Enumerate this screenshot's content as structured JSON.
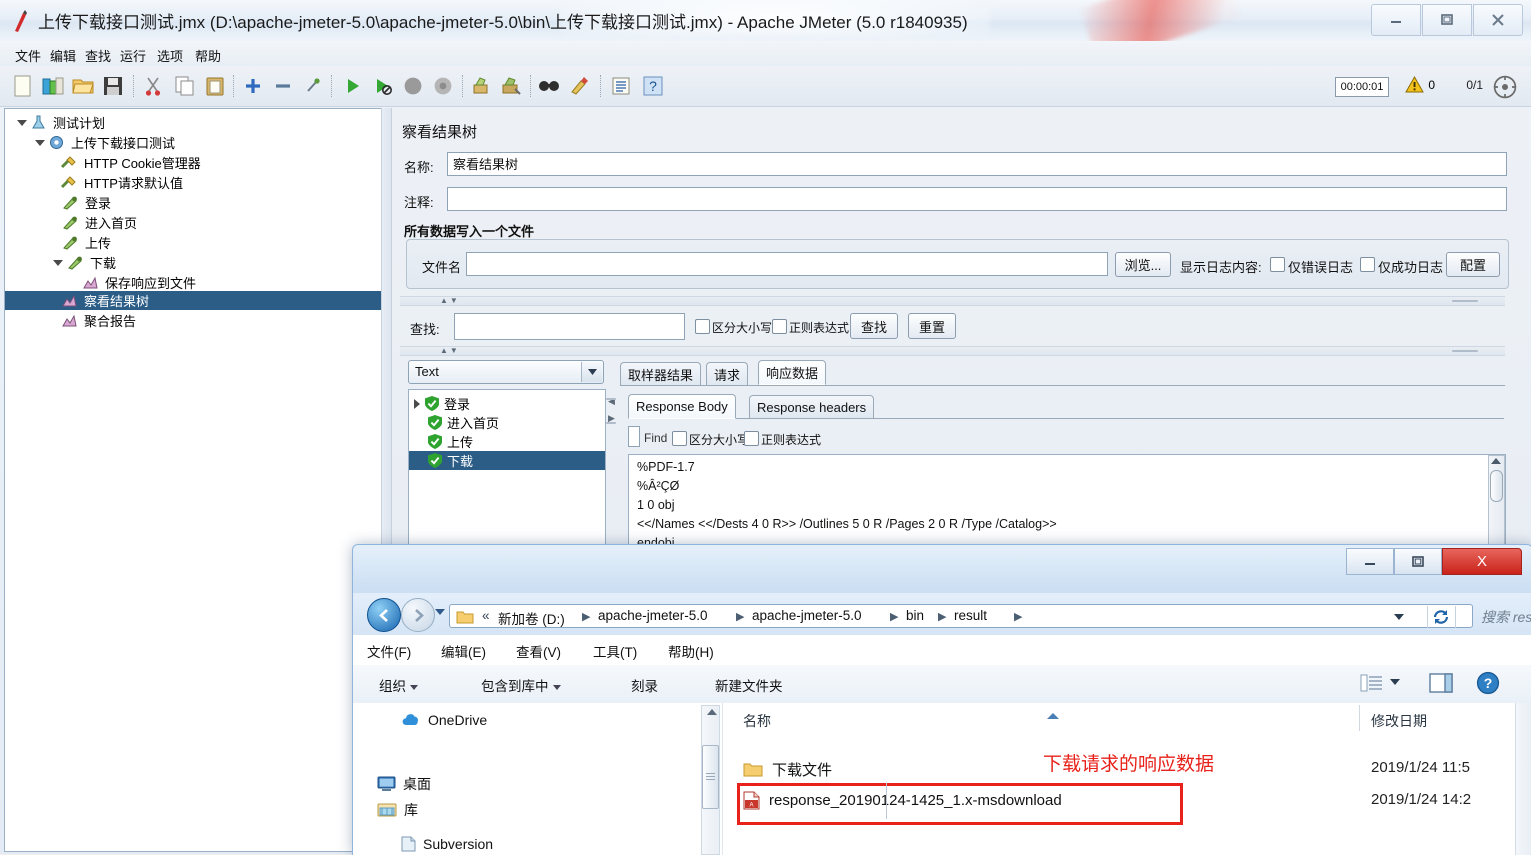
{
  "jmeter": {
    "title": "上传下载接口测试.jmx (D:\\apache-jmeter-5.0\\apache-jmeter-5.0\\bin\\上传下载接口测试.jmx) - Apache JMeter (5.0 r1840935)",
    "window_buttons": {
      "minimize": "—",
      "maximize": "❐",
      "close": "✕"
    },
    "menu": [
      "文件",
      "编辑",
      "查找",
      "运行",
      "选项",
      "帮助"
    ],
    "toolbar": {
      "icons": [
        "new-icon",
        "templates-icon",
        "open-icon",
        "save-icon",
        "cut-icon",
        "copy-icon",
        "paste-icon",
        "expand-icon",
        "collapse-icon",
        "toggle-icon",
        "start-icon",
        "start-no-pause-icon",
        "stop-icon",
        "shutdown-icon",
        "clear-icon",
        "clear-all-icon",
        "search-icon",
        "search-reset-icon",
        "function-helper-icon",
        "help-icon"
      ],
      "elapsed": "00:00:01",
      "warn_count": "0",
      "thread_ratio": "0/1"
    },
    "tree": {
      "nodes": [
        {
          "label": "测试计划",
          "icon": "test-plan-icon",
          "depth": 0,
          "toggle": "down",
          "selected": false
        },
        {
          "label": "上传下载接口测试",
          "icon": "thread-group-icon",
          "depth": 1,
          "toggle": "down",
          "selected": false
        },
        {
          "label": "HTTP Cookie管理器",
          "icon": "config-icon",
          "depth": 2,
          "toggle": "none",
          "selected": false
        },
        {
          "label": "HTTP请求默认值",
          "icon": "config-icon",
          "depth": 2,
          "toggle": "none",
          "selected": false
        },
        {
          "label": "登录",
          "icon": "http-sampler-icon",
          "depth": 2,
          "toggle": "none",
          "selected": false
        },
        {
          "label": "进入首页",
          "icon": "http-sampler-icon",
          "depth": 2,
          "toggle": "none",
          "selected": false
        },
        {
          "label": "上传",
          "icon": "http-sampler-icon",
          "depth": 2,
          "toggle": "none",
          "selected": false
        },
        {
          "label": "下载",
          "icon": "http-sampler-icon",
          "depth": 2,
          "toggle": "down",
          "selected": false
        },
        {
          "label": "保存响应到文件",
          "icon": "listener-icon",
          "depth": 3,
          "toggle": "none",
          "selected": false
        },
        {
          "label": "察看结果树",
          "icon": "listener-icon",
          "depth": 2,
          "toggle": "none",
          "selected": true
        },
        {
          "label": "聚合报告",
          "icon": "listener-icon",
          "depth": 2,
          "toggle": "none",
          "selected": false
        }
      ]
    },
    "panel": {
      "heading": "察看结果树",
      "name_label": "名称:",
      "name_value": "察看结果树",
      "comment_label": "注释:",
      "comment_value": "",
      "group_heading": "所有数据写入一个文件",
      "filename_label": "文件名",
      "filename_value": "",
      "browse_button": "浏览...",
      "log_display_label": "显示日志内容:",
      "errors_only": "仅错误日志",
      "success_only": "仅成功日志",
      "configure_button": "配置",
      "find_label": "查找:",
      "find_value": "",
      "case_sensitive": "区分大小写",
      "regex": "正则表达式",
      "find_button": "查找",
      "reset_button": "重置",
      "renderer_selected": "Text",
      "results": [
        {
          "label": "登录",
          "icon": "success-shield-icon",
          "toggle": "right",
          "selected": false
        },
        {
          "label": "进入首页",
          "icon": "success-shield-icon",
          "toggle": "none",
          "selected": false
        },
        {
          "label": "上传",
          "icon": "success-shield-icon",
          "toggle": "none",
          "selected": false
        },
        {
          "label": "下载",
          "icon": "success-shield-icon",
          "toggle": "none",
          "selected": true
        }
      ],
      "main_tabs": [
        {
          "label": "取样器结果",
          "active": false
        },
        {
          "label": "请求",
          "active": false
        },
        {
          "label": "响应数据",
          "active": true
        }
      ],
      "sub_tabs": [
        {
          "label": "Response Body",
          "active": true
        },
        {
          "label": "Response headers",
          "active": false
        }
      ],
      "find_bar": {
        "find_label": "Find",
        "case_sensitive": "区分大小写",
        "regex": "正则表达式"
      },
      "response_lines": [
        "%PDF-1.7",
        "%Â²ÇØ",
        "1 0 obj",
        "<</Names <</Dests 4 0 R>> /Outlines 5 0 R /Pages 2 0 R /Type /Catalog>>",
        "endobj"
      ]
    }
  },
  "explorer": {
    "window_buttons": {
      "minimize": "—",
      "maximize": "❐",
      "close": "X"
    },
    "nav": {
      "back": "back-icon",
      "forward": "forward-icon",
      "recent": "recent-pages-icon",
      "refresh": "refresh-icon"
    },
    "breadcrumbs": [
      "新加卷 (D:)",
      "apache-jmeter-5.0",
      "apache-jmeter-5.0",
      "bin",
      "result"
    ],
    "breadcrumb_prefix": "«",
    "search_placeholder": "搜索 result",
    "menu": [
      "文件(F)",
      "编辑(E)",
      "查看(V)",
      "工具(T)",
      "帮助(H)"
    ],
    "toolbar": [
      {
        "label": "组织",
        "caret": true
      },
      {
        "label": "包含到库中",
        "caret": true
      },
      {
        "label": "刻录",
        "caret": false
      },
      {
        "label": "新建文件夹",
        "caret": false
      }
    ],
    "toolbar_right": [
      "view-list-icon",
      "preview-pane-icon",
      "help-icon"
    ],
    "nav_pane": [
      {
        "label": "OneDrive",
        "icon": "onedrive-icon",
        "indent": 0
      },
      {
        "label": "桌面",
        "icon": "desktop-icon",
        "indent": 0
      },
      {
        "label": "库",
        "icon": "library-icon",
        "indent": 0
      },
      {
        "label": "Subversion",
        "icon": "subversion-icon",
        "indent": 1
      }
    ],
    "columns": [
      "名称",
      "修改日期"
    ],
    "files": [
      {
        "name": "下载文件",
        "icon": "folder-icon",
        "date": "2019/1/24 11:5",
        "highlighted": false
      },
      {
        "name": "response_20190124-1425_1.x-msdownload",
        "icon": "pdf-file-icon",
        "date": "2019/1/24 14:2",
        "highlighted": true
      }
    ],
    "annotation": "下载请求的响应数据",
    "annotation_color": "#e8221a"
  }
}
